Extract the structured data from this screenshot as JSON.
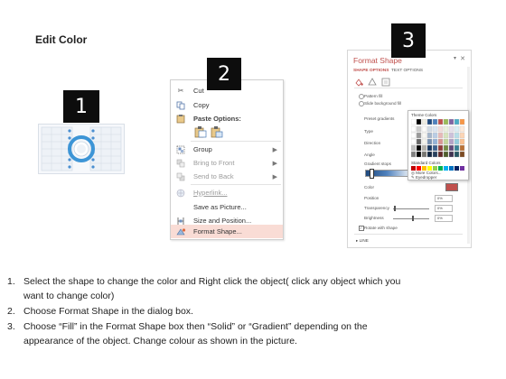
{
  "heading": "Edit Color",
  "badges": [
    "1",
    "2",
    "3"
  ],
  "menu": {
    "cut_label": "Cut",
    "items": [
      {
        "label": "Copy",
        "icon": "copy-icon",
        "enabled": true,
        "submenu": false
      },
      {
        "label": "Paste Options:",
        "icon": "paste-icon",
        "enabled": true,
        "submenu": false
      },
      {
        "label": "Group",
        "icon": "group-icon",
        "enabled": true,
        "submenu": true
      },
      {
        "label": "Bring to Front",
        "icon": "bring-to-front-icon",
        "enabled": false,
        "submenu": true
      },
      {
        "label": "Send to Back",
        "icon": "send-to-back-icon",
        "enabled": false,
        "submenu": true
      },
      {
        "label": "Hyperlink...",
        "icon": "hyperlink-icon",
        "enabled": false,
        "submenu": false
      },
      {
        "label": "Save as Picture...",
        "icon": "save-as-picture-icon",
        "enabled": true,
        "submenu": false
      },
      {
        "label": "Size and Position...",
        "icon": "size-position-icon",
        "enabled": true,
        "submenu": false
      },
      {
        "label": "Format Shape...",
        "icon": "format-shape-icon",
        "enabled": true,
        "submenu": false
      }
    ]
  },
  "format_panel": {
    "title": "Format Shape",
    "tabs": [
      "SHAPE OPTIONS",
      "TEXT OPTIONS"
    ],
    "options": [
      "Pattern fill",
      "Slide background fill"
    ],
    "fields": [
      "Preset gradients",
      "Type",
      "Direction",
      "Angle",
      "Gradient stops"
    ],
    "color_label": "Color",
    "position_label": "Position",
    "position_value": "0%",
    "transparency_label": "Transparency",
    "transparency_value": "0%",
    "brightness_label": "Brightness",
    "brightness_value": "0%",
    "rotate_label": "Rotate with shape",
    "line_label": "LINE",
    "popup": {
      "theme_colors_label": "Theme Colors",
      "standard_colors_label": "Standard Colors",
      "more_colors_label": "More Colors...",
      "eyedropper_label": "Eyedropper"
    }
  },
  "theme_columns": [
    "#ffffff",
    "#000000",
    "#eeece1",
    "#1f497d",
    "#4f81bd",
    "#c0504d",
    "#9bbb59",
    "#8064a2",
    "#4bacc6",
    "#f79646"
  ],
  "standard_colors": [
    "#c00000",
    "#ff0000",
    "#ffc000",
    "#ffff00",
    "#92d050",
    "#00b050",
    "#00b0f0",
    "#0070c0",
    "#002060",
    "#7030a0"
  ],
  "instructions": [
    {
      "number": "1.",
      "text": "Select the shape to change the color and Right click the object( click any object which you",
      "continuation": "want to change color)"
    },
    {
      "number": "2.",
      "text": "Choose Format Shape in the dialog box."
    },
    {
      "number": "3.",
      "text": "Choose “Fill” in the Format Shape box then “Solid” or “Gradient” depending on the",
      "continuation": "appearance of the object. Change colour as shown in the picture."
    }
  ]
}
